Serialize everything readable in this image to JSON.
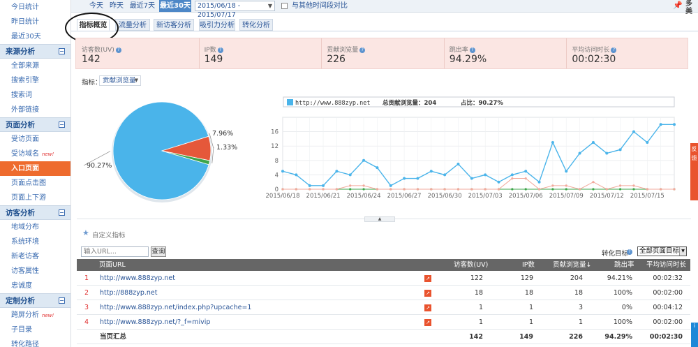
{
  "sidebar": {
    "top_items": [
      "今日统计",
      "昨日统计",
      "最近30天"
    ],
    "groups": [
      {
        "title": "来源分析",
        "toggle": "⊟",
        "items": [
          {
            "label": "全部来源"
          },
          {
            "label": "搜索引擎"
          },
          {
            "label": "搜索词"
          },
          {
            "label": "外部链接"
          }
        ]
      },
      {
        "title": "页面分析",
        "toggle": "⊟",
        "items": [
          {
            "label": "受访页面"
          },
          {
            "label": "受访域名",
            "badge": "new!"
          },
          {
            "label": "入口页面",
            "active": true
          },
          {
            "label": "页面点击图"
          },
          {
            "label": "页面上下游"
          }
        ]
      },
      {
        "title": "访客分析",
        "toggle": "⊟",
        "items": [
          {
            "label": "地域分布"
          },
          {
            "label": "系统环境"
          },
          {
            "label": "新老访客"
          },
          {
            "label": "访客属性"
          },
          {
            "label": "忠诚度"
          }
        ]
      },
      {
        "title": "定制分析",
        "toggle": "⊟",
        "items": [
          {
            "label": "跨屏分析",
            "badge": "new!"
          },
          {
            "label": "子目录"
          },
          {
            "label": "转化路径"
          }
        ]
      }
    ]
  },
  "datebar": {
    "buttons": [
      "今天",
      "昨天",
      "最近7天",
      "最近30天"
    ],
    "active_index": 3,
    "range": "2015/06/18 - 2015/07/17",
    "compare_label": "与其他时间段对比"
  },
  "tabs": [
    "指标概览",
    "流量分析",
    "新访客分析",
    "吸引力分析",
    "转化分析"
  ],
  "active_tab": 0,
  "metrics": [
    {
      "label": "访客数(UV)",
      "value": "142"
    },
    {
      "label": "IP数",
      "value": "149"
    },
    {
      "label": "贡献浏览量",
      "value": "226"
    },
    {
      "label": "跳出率",
      "value": "94.29%"
    },
    {
      "label": "平均访问时长",
      "value": "00:02:30"
    }
  ],
  "indicator": {
    "label": "指标：",
    "value": "贡献浏览量"
  },
  "pie": {
    "slices": [
      {
        "value": 90.27,
        "label": "90.27%",
        "color": "#4ab4ea"
      },
      {
        "value": 7.96,
        "label": "7.96%",
        "color": "#e5583a"
      },
      {
        "value": 1.33,
        "label": "1.33%",
        "color": "#3da54a"
      }
    ]
  },
  "line_legend": {
    "url": "http://www.888zyp.net",
    "total": "总贡献浏览量：204",
    "ratio": "占比：90.27%"
  },
  "chart_data": {
    "type": "line",
    "x": [
      "2015/06/18",
      "2015/06/19",
      "2015/06/20",
      "2015/06/21",
      "2015/06/22",
      "2015/06/23",
      "2015/06/24",
      "2015/06/25",
      "2015/06/26",
      "2015/06/27",
      "2015/06/28",
      "2015/06/29",
      "2015/06/30",
      "2015/07/01",
      "2015/07/02",
      "2015/07/03",
      "2015/07/04",
      "2015/07/05",
      "2015/07/06",
      "2015/07/07",
      "2015/07/08",
      "2015/07/09",
      "2015/07/10",
      "2015/07/11",
      "2015/07/12",
      "2015/07/13",
      "2015/07/14",
      "2015/07/15",
      "2015/07/16",
      "2015/07/17"
    ],
    "x_tick_labels": [
      "2015/06/18",
      "2015/06/21",
      "2015/06/24",
      "2015/06/27",
      "2015/06/30",
      "2015/07/03",
      "2015/07/06",
      "2015/07/09",
      "2015/07/12",
      "2015/07/15"
    ],
    "series": [
      {
        "color": "#4ab4ea",
        "values": [
          5,
          4,
          1,
          1,
          5,
          4,
          8,
          6,
          1,
          3,
          3,
          5,
          4,
          7,
          3,
          4,
          2,
          4,
          5,
          2,
          13,
          5,
          10,
          13,
          10,
          11,
          16,
          13,
          18,
          18
        ]
      },
      {
        "color": "#f2a99c",
        "values": [
          0,
          0,
          0,
          0,
          0,
          1,
          1,
          0,
          0,
          0,
          0,
          0,
          0,
          0,
          0,
          0,
          0,
          3,
          3,
          0,
          1,
          1,
          0,
          2,
          0,
          1,
          1,
          0,
          0,
          0
        ]
      },
      {
        "color": "#3da54a",
        "values": [
          0,
          0,
          0,
          0,
          0,
          0,
          0,
          0,
          0,
          0,
          0,
          0,
          0,
          0,
          0,
          0,
          0,
          0,
          0,
          0,
          0,
          0,
          0,
          0,
          0,
          0,
          0,
          0,
          0,
          0
        ]
      }
    ],
    "ylim": [
      0,
      20
    ],
    "yticks": [
      0,
      4,
      8,
      12,
      16,
      20
    ],
    "grid": true
  },
  "custom_indicator": "自定义指标",
  "filter": {
    "placeholder": "输入URL...",
    "query": "查询",
    "conv_label": "转化目标",
    "conv_value": "全部页面目标"
  },
  "table": {
    "headers": [
      "页面URL",
      "访客数(UV)",
      "IP数",
      "贡献浏览量",
      "跳出率",
      "平均访问时长"
    ],
    "rows": [
      {
        "num": "1",
        "url": "http://www.888zyp.net",
        "uv": "122",
        "ip": "129",
        "pv": "204",
        "bounce": "94.21%",
        "time": "00:02:32"
      },
      {
        "num": "2",
        "url": "http://888zyp.net",
        "uv": "18",
        "ip": "18",
        "pv": "18",
        "bounce": "100%",
        "time": "00:02:00"
      },
      {
        "num": "3",
        "url": "http://www.888zyp.net/index.php?upcache=1",
        "uv": "1",
        "ip": "1",
        "pv": "3",
        "bounce": "0%",
        "time": "00:04:12"
      },
      {
        "num": "4",
        "url": "http://www.888zyp.net/?_f=mivip",
        "uv": "1",
        "ip": "1",
        "pv": "1",
        "bounce": "100%",
        "time": "00:02:00"
      }
    ],
    "total": {
      "label": "当页汇总",
      "uv": "142",
      "ip": "149",
      "pv": "226",
      "bounce": "94.29%",
      "time": "00:02:30"
    }
  },
  "side": {
    "feedback": "反馈"
  }
}
